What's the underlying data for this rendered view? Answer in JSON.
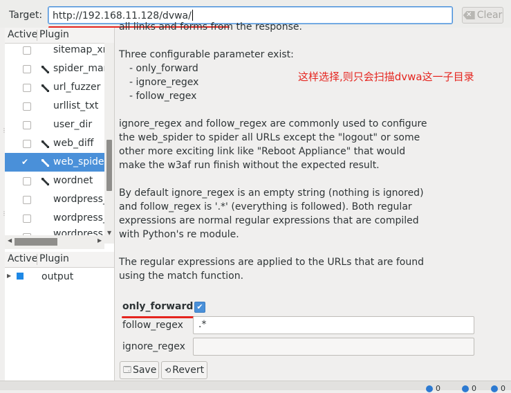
{
  "target": {
    "label": "Target:",
    "url": "http://192.168.11.128/dvwa/",
    "clear_label": "Clear"
  },
  "plugin_list": {
    "header_active": "Active",
    "header_plugin": "Plugin",
    "rows": [
      {
        "name": "sitemap_xml",
        "checked": false,
        "configurable": false
      },
      {
        "name": "spider_man",
        "checked": false,
        "configurable": true
      },
      {
        "name": "url_fuzzer",
        "checked": false,
        "configurable": true
      },
      {
        "name": "urllist_txt",
        "checked": false,
        "configurable": false
      },
      {
        "name": "user_dir",
        "checked": false,
        "configurable": false
      },
      {
        "name": "web_diff",
        "checked": false,
        "configurable": true
      },
      {
        "name": "web_spider",
        "checked": true,
        "configurable": true,
        "selected": true
      },
      {
        "name": "wordnet",
        "checked": false,
        "configurable": true
      },
      {
        "name": "wordpress_",
        "checked": false,
        "configurable": false
      },
      {
        "name": "wordpress_",
        "checked": false,
        "configurable": false
      },
      {
        "name": "wordpress_",
        "checked": false,
        "configurable": false
      }
    ]
  },
  "output_list": {
    "header_active": "Active",
    "header_plugin": "Plugin",
    "rows": [
      {
        "name": "output"
      }
    ]
  },
  "description": {
    "partial_top": "all links and forms from the response.",
    "p1_intro": "Three configurable parameter exist:",
    "p1_items": [
      "- only_forward",
      "- ignore_regex",
      "- follow_regex"
    ],
    "p2": "ignore_regex and follow_regex are commonly used to configure the web_spider to spider all URLs except the \"logout\" or some other more exciting link like \"Reboot Appliance\" that would make the w3af run finish without the expected result.",
    "p3": "By default ignore_regex is an empty string (nothing is ignored) and follow_regex is '.*' (everything is followed). Both regular expressions are normal regular expressions that are compiled with Python's re module.",
    "p4": "The regular expressions are applied to the URLs that are found using the match function."
  },
  "annotation_note": "这样选择,则只会扫描dvwa这一子目录",
  "options": {
    "only_forward_label": "only_forward",
    "only_forward_checked": true,
    "follow_regex_label": "follow_regex",
    "follow_regex_value": ".*",
    "ignore_regex_label": "ignore_regex",
    "ignore_regex_value": ""
  },
  "buttons": {
    "save_label": "Save",
    "revert_label": "Revert"
  },
  "status": {
    "items": [
      "0",
      "0",
      "0"
    ]
  },
  "colors": {
    "selection": "#4a90d9",
    "annotation_red": "#e5241e",
    "output_square": "#1e88e5"
  }
}
